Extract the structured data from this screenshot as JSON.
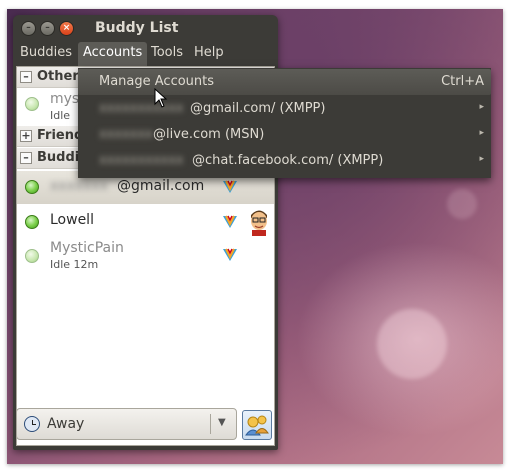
{
  "window": {
    "title": "Buddy List",
    "buttons": [
      "–",
      "–",
      "×"
    ]
  },
  "menubar": {
    "items": [
      {
        "label": "Buddies"
      },
      {
        "label": "Accounts"
      },
      {
        "label": "Tools"
      },
      {
        "label": "Help"
      }
    ]
  },
  "buddy_list": {
    "groups": [
      {
        "label": "Other",
        "expander": "–"
      },
      {
        "label": "Friends",
        "expander": "+"
      },
      {
        "label": "Buddies",
        "expander": "–"
      }
    ],
    "other_buddy": {
      "name_partial": "mys",
      "sub": "Idle"
    },
    "selected_buddy": {
      "name_suffix": "@gmail.com"
    },
    "buddies": [
      {
        "name": "Lowell",
        "status": "available"
      },
      {
        "name": "MysticPain",
        "sub": "Idle 12m",
        "status": "idle"
      }
    ]
  },
  "status": {
    "label": "Away",
    "arrow": "▼"
  },
  "accounts_menu": {
    "items": [
      {
        "label": "Manage Accounts",
        "shortcut": "Ctrl+A"
      },
      {
        "label": "@gmail.com/ (XMPP)",
        "arrow": "▸"
      },
      {
        "label": "@live.com (MSN)",
        "arrow": "▸"
      },
      {
        "label": "@chat.facebook.com/ (XMPP)",
        "arrow": "▸"
      }
    ]
  },
  "colors": {
    "window_bg": "#3c3b37",
    "menu_text": "#dfdbd2",
    "highlight": "#5d5c57"
  }
}
